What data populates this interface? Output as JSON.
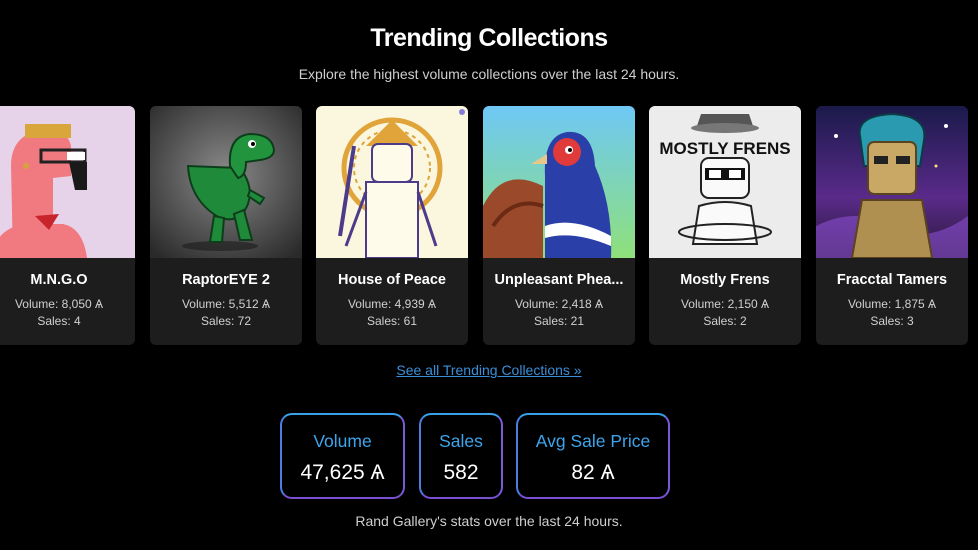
{
  "header": {
    "title": "Trending Collections",
    "subtitle": "Explore the highest volume collections over the last 24 hours."
  },
  "collections": [
    {
      "name": "M.N.G.O",
      "volume": "Volume: 8,050 Ѧ",
      "sales": "Sales: 4",
      "image": "pink-flamingo-avatar"
    },
    {
      "name": "RaptorEYE 2",
      "volume": "Volume: 5,512 Ѧ",
      "sales": "Sales: 72",
      "image": "green-raptor-avatar"
    },
    {
      "name": "House of Peace",
      "volume": "Volume: 4,939 Ѧ",
      "sales": "Sales: 61",
      "image": "samurai-avatar"
    },
    {
      "name": "Unpleasant Phea...",
      "volume": "Volume: 2,418 Ѧ",
      "sales": "Sales: 21",
      "image": "pheasant-avatar"
    },
    {
      "name": "Mostly Frens",
      "volume": "Volume: 2,150 Ѧ",
      "sales": "Sales: 2",
      "image": "mostly-frens-avatar",
      "image_text": "MOSTLY FRENS"
    },
    {
      "name": "Fracctal Tamers",
      "volume": "Volume: 1,875 Ѧ",
      "sales": "Sales: 3",
      "image": "tamer-avatar"
    }
  ],
  "see_all": "See all Trending Collections »",
  "stats": [
    {
      "label": "Volume",
      "value": "47,625 Ѧ"
    },
    {
      "label": "Sales",
      "value": "582"
    },
    {
      "label": "Avg Sale Price",
      "value": "82 Ѧ"
    }
  ],
  "footer": "Rand Gallery's stats over the last 24 hours.",
  "colors": {
    "background": "#000000",
    "accent": "#3ea5ec",
    "link": "#3b8fd9",
    "card": "#1d1d1d"
  }
}
